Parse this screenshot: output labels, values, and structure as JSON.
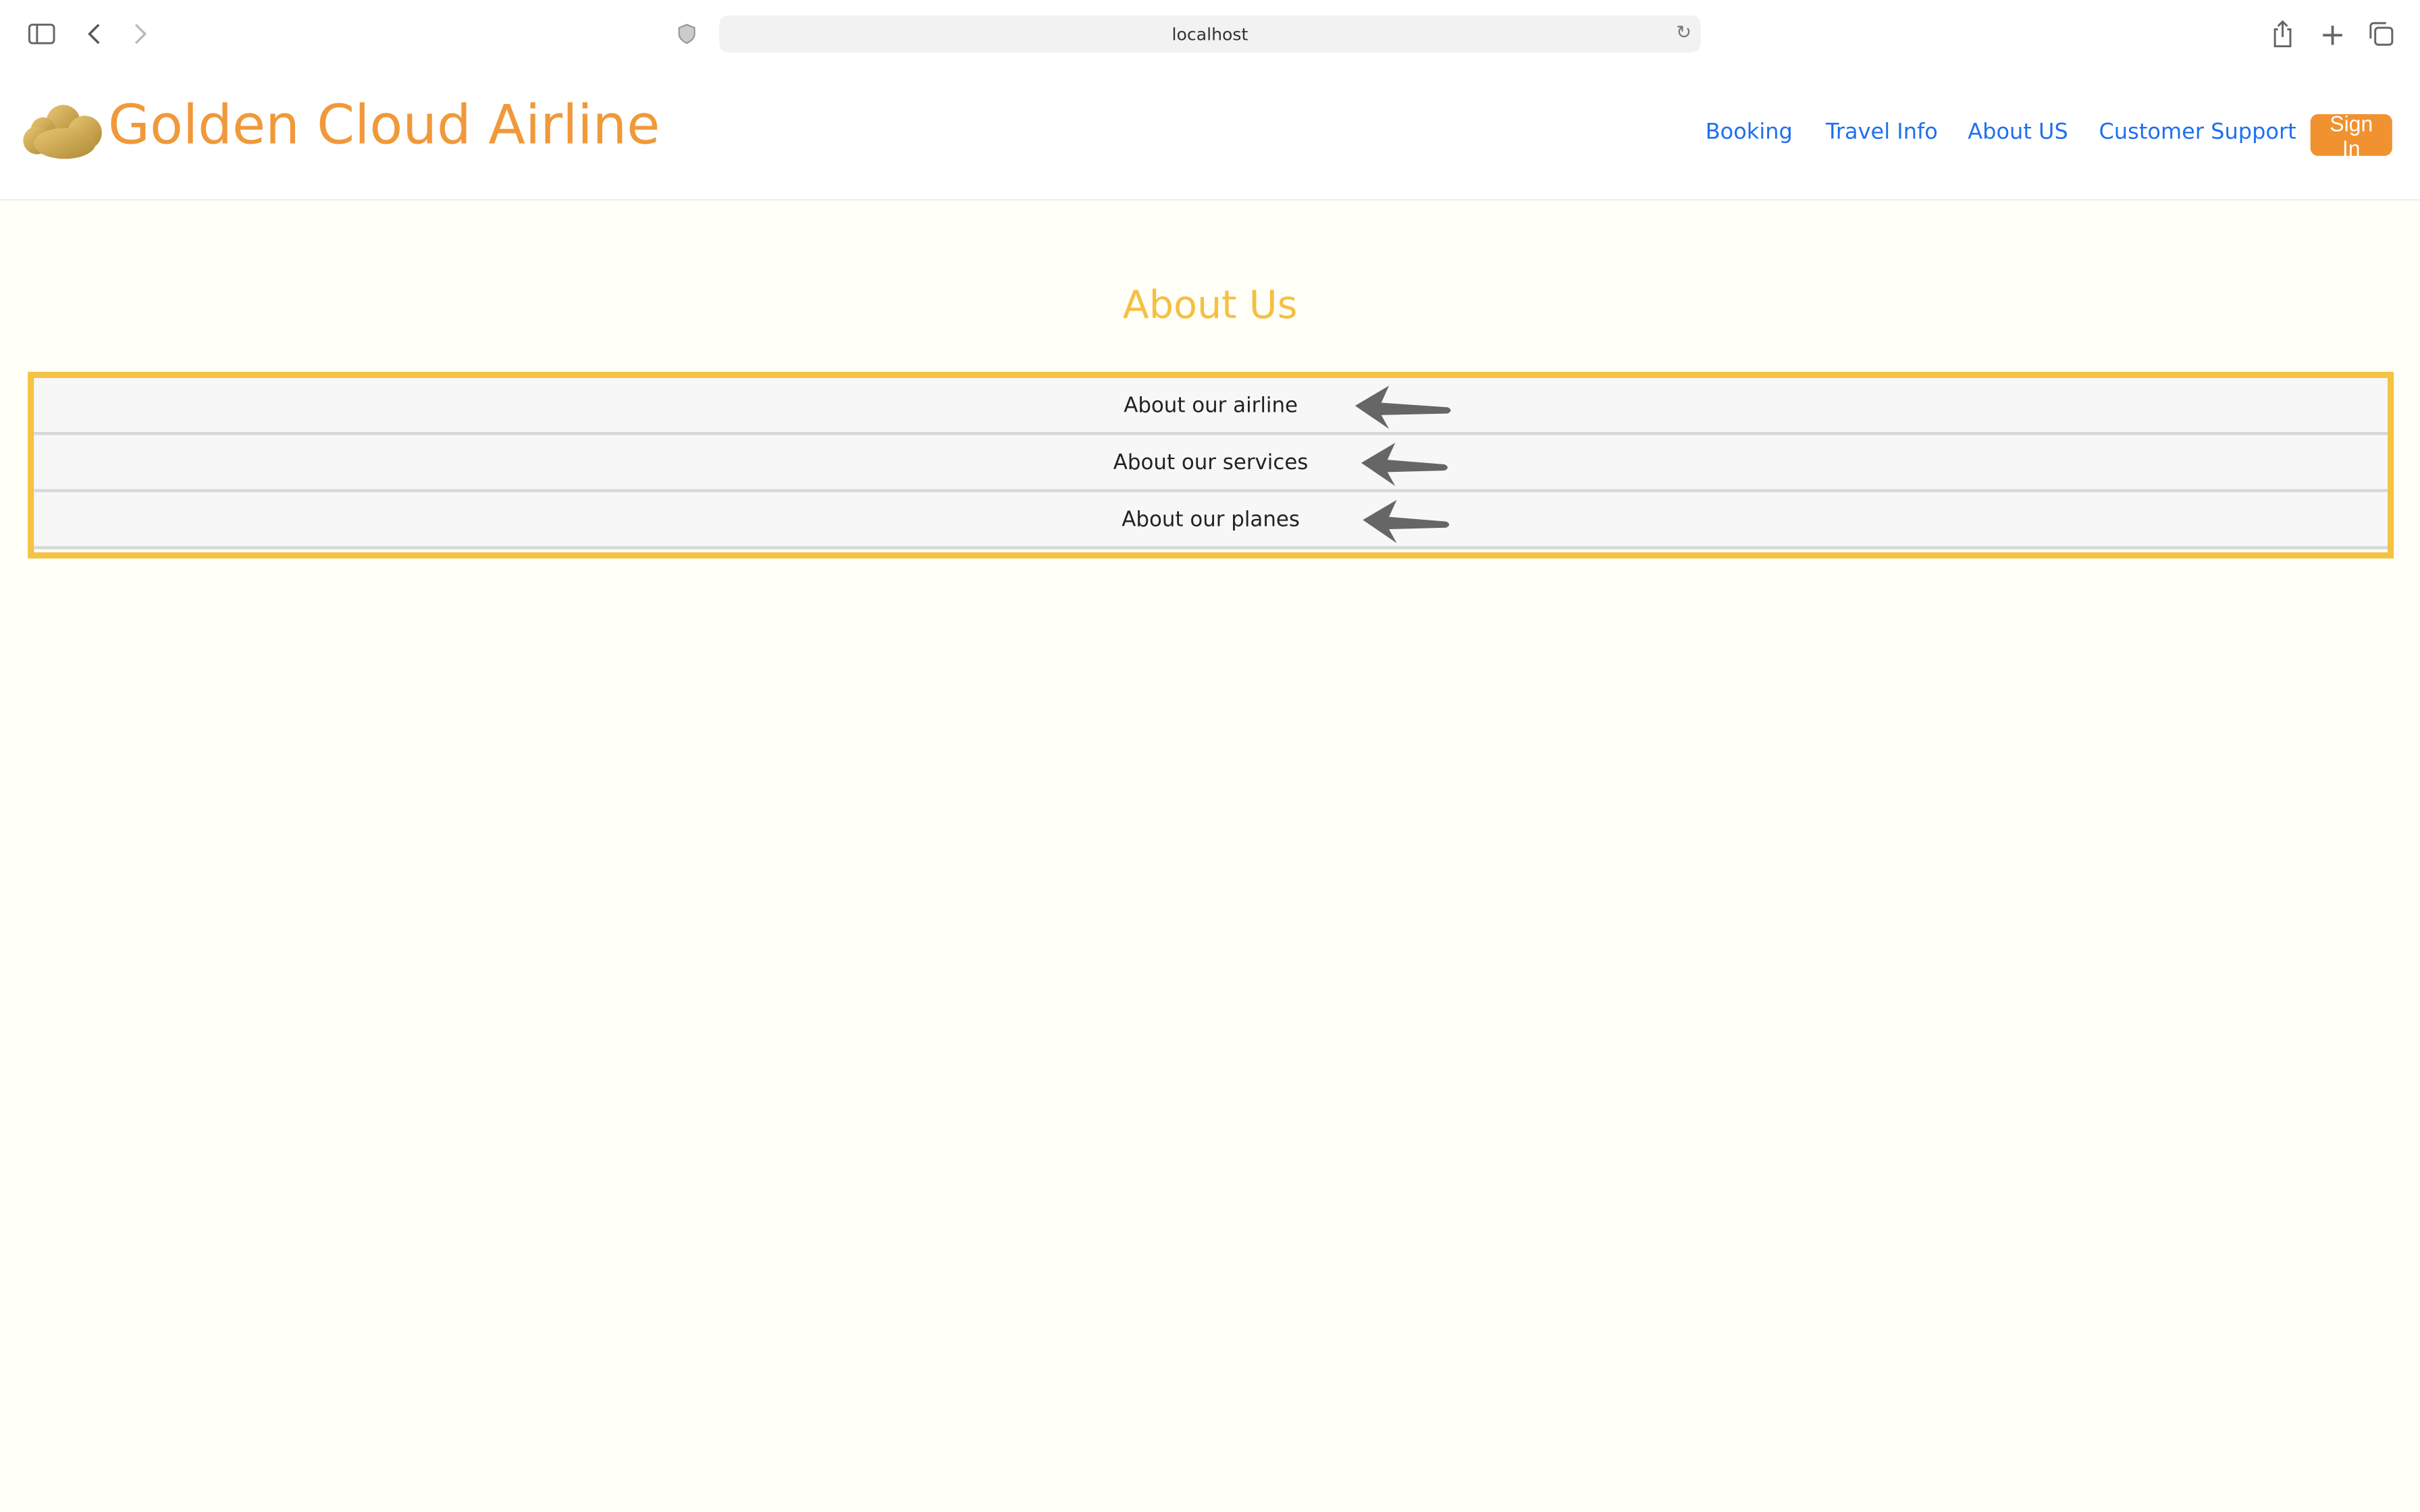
{
  "browser": {
    "url": "localhost",
    "icons": [
      "sidebar-icon",
      "back-icon",
      "forward-icon",
      "shield-icon",
      "reload-icon",
      "share-icon",
      "new-tab-icon",
      "tabs-icon"
    ]
  },
  "header": {
    "brand": "Golden Cloud Airline",
    "nav": [
      "Booking",
      "Travel Info",
      "About US",
      "Customer Support"
    ],
    "sign_in": "Sign In"
  },
  "main": {
    "title": "About Us",
    "items": [
      "About our airline",
      "About our services",
      "About our planes"
    ]
  },
  "colors": {
    "brand": "#f0993a",
    "link": "#1f6ff0",
    "accent_border": "#f5c342",
    "title": "#f5c040",
    "button": "#f0922f",
    "background": "#fffef7"
  }
}
